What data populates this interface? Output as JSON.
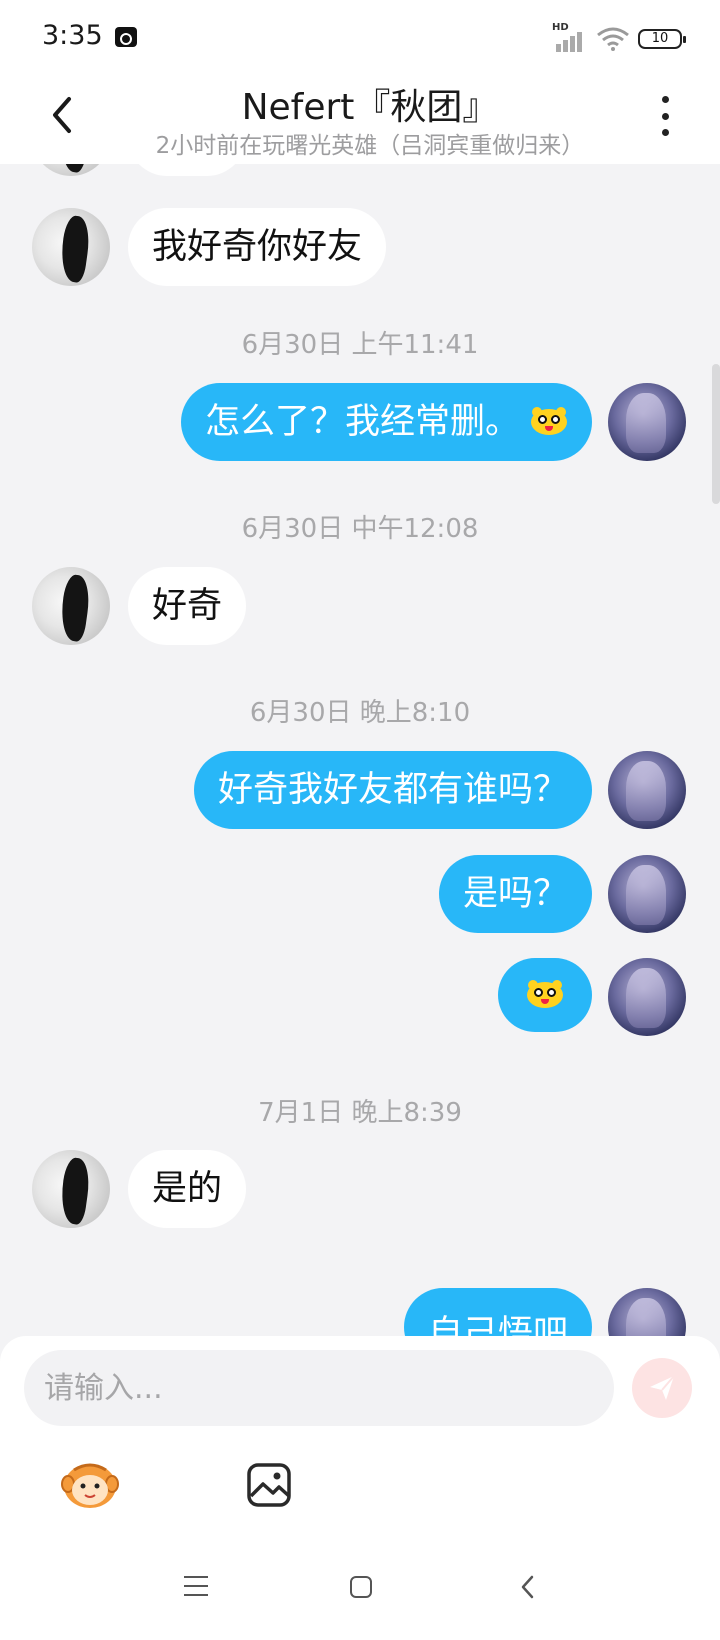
{
  "status_bar": {
    "time": "3:35",
    "network_label": "HD",
    "battery_level": "10"
  },
  "header": {
    "title": "Nefert『秋团』",
    "subtitle": "2小时前在玩曙光英雄（吕洞宾重做归来）"
  },
  "messages": [
    {
      "type": "in",
      "text": "我好奇你好友"
    },
    {
      "type": "time",
      "text": "6月30日 上午11:41"
    },
    {
      "type": "out",
      "text": "怎么了？我经常删。",
      "emoji": "smiley-sticker-icon"
    },
    {
      "type": "time",
      "text": "6月30日 中午12:08"
    },
    {
      "type": "in",
      "text": "好奇"
    },
    {
      "type": "time",
      "text": "6月30日 晚上8:10"
    },
    {
      "type": "out",
      "text": "好奇我好友都有谁吗？"
    },
    {
      "type": "out",
      "text": "是吗？"
    },
    {
      "type": "out",
      "text": "",
      "emoji": "smiley-sticker-icon"
    },
    {
      "type": "time",
      "text": "7月1日 晚上8:39"
    },
    {
      "type": "in",
      "text": "是的"
    },
    {
      "type": "out",
      "text": "自己悟吧"
    }
  ],
  "input": {
    "placeholder": "请输入..."
  },
  "colors": {
    "outgoing_bubble": "#28b7f8",
    "incoming_bubble": "#ffffff",
    "background": "#f3f3f5",
    "send_button": "#fde3e3"
  }
}
